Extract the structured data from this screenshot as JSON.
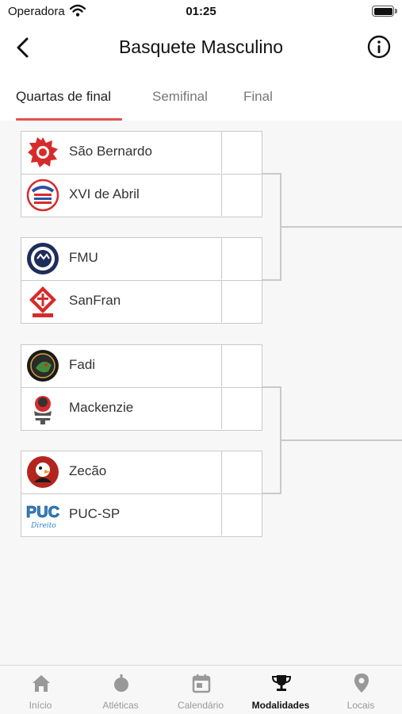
{
  "status_bar": {
    "carrier": "Operadora",
    "time": "01:25"
  },
  "header": {
    "title": "Basquete Masculino"
  },
  "tabs": [
    {
      "label": "Quartas de final",
      "active": true
    },
    {
      "label": "Semifinal",
      "active": false
    },
    {
      "label": "Final",
      "active": false
    }
  ],
  "matches": [
    {
      "teams": [
        {
          "name": "São Bernardo",
          "score": "",
          "logo": "sao-bernardo-logo"
        },
        {
          "name": "XVI de Abril",
          "score": "",
          "logo": "xvi-de-abril-logo"
        }
      ]
    },
    {
      "teams": [
        {
          "name": "FMU",
          "score": "",
          "logo": "fmu-logo"
        },
        {
          "name": "SanFran",
          "score": "",
          "logo": "sanfran-logo"
        }
      ]
    },
    {
      "teams": [
        {
          "name": "Fadi",
          "score": "",
          "logo": "fadi-logo"
        },
        {
          "name": "Mackenzie",
          "score": "",
          "logo": "mackenzie-logo"
        }
      ]
    },
    {
      "teams": [
        {
          "name": "Zecão",
          "score": "",
          "logo": "zecao-logo"
        },
        {
          "name": "PUC-SP",
          "score": "",
          "logo": "puc-sp-logo"
        }
      ]
    }
  ],
  "logo_text": {
    "puc": "PUC",
    "puc_sub": "Direito"
  },
  "tab_bar": [
    {
      "label": "Início",
      "icon": "home-icon",
      "active": false
    },
    {
      "label": "Atléticas",
      "icon": "athletics-icon",
      "active": false
    },
    {
      "label": "Calendário",
      "icon": "calendar-icon",
      "active": false
    },
    {
      "label": "Modalidades",
      "icon": "trophy-icon",
      "active": true
    },
    {
      "label": "Locais",
      "icon": "location-pin-icon",
      "active": false
    }
  ],
  "colors": {
    "accent": "#e0534e",
    "active_tab_icon": "#111111",
    "inactive_tab_icon": "#999999"
  }
}
